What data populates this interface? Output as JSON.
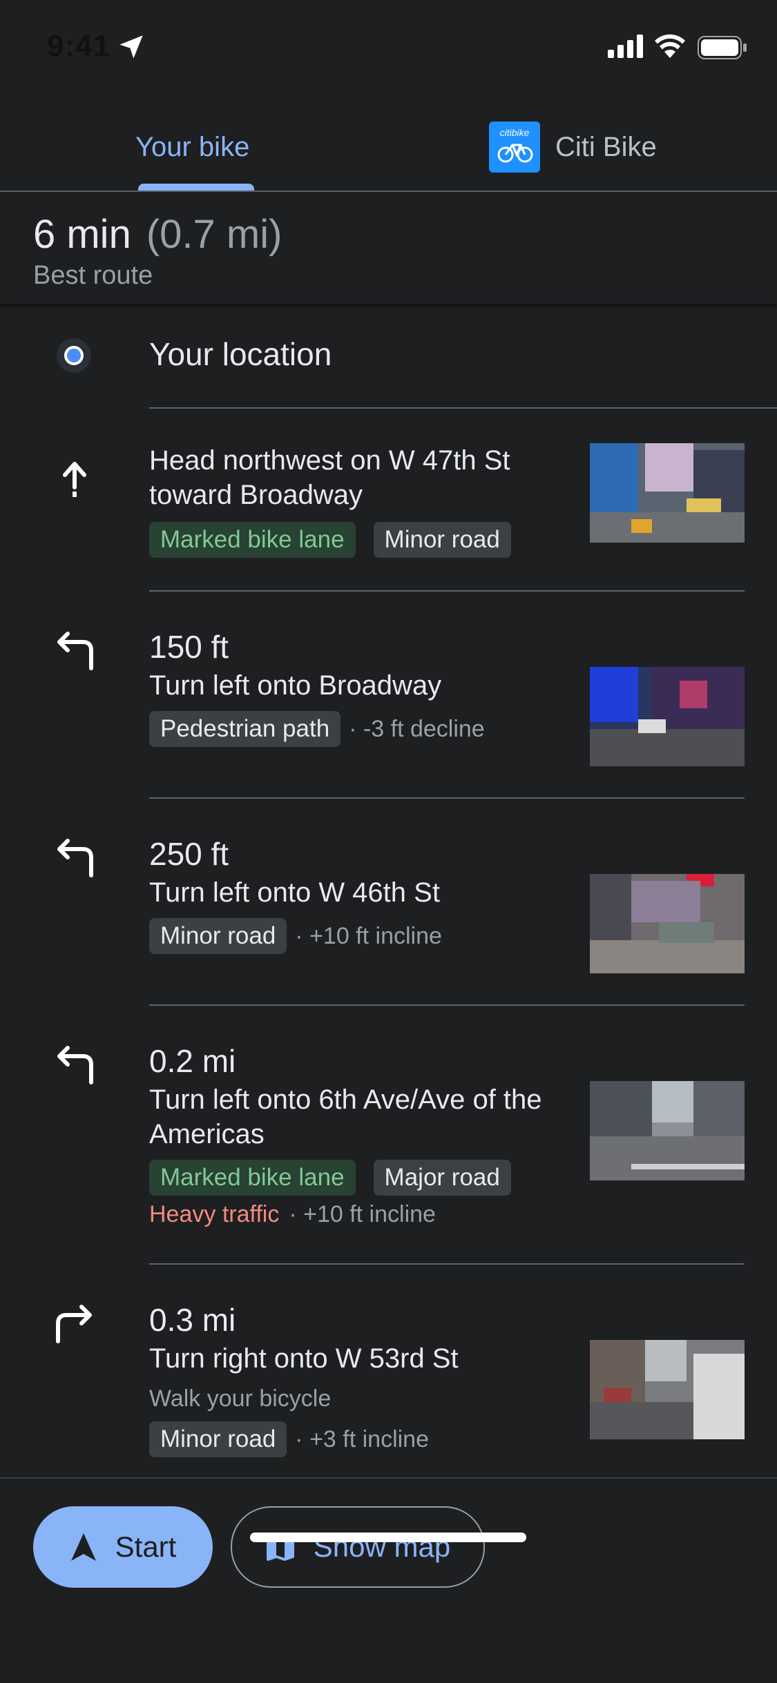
{
  "status_bar": {
    "time": "9:41"
  },
  "tabs": [
    {
      "label": "Your bike",
      "active": true
    },
    {
      "label": "Citi Bike",
      "active": false,
      "logo_text": "citibike"
    }
  ],
  "summary": {
    "duration": "6 min",
    "distance": "(0.7 mi)",
    "route_label": "Best route"
  },
  "origin": {
    "label": "Your location"
  },
  "steps": [
    {
      "icon": "straight-arrow-icon",
      "distance": "",
      "instruction": "Head northwest on W 47th St toward Broadway",
      "chips": [
        {
          "label": "Marked bike lane",
          "style": "green"
        },
        {
          "label": "Minor road",
          "style": "gray"
        }
      ],
      "meta": ""
    },
    {
      "icon": "turn-left-icon",
      "distance": "150 ft",
      "instruction": "Turn left onto Broadway",
      "chips": [
        {
          "label": "Pedestrian path",
          "style": "gray"
        }
      ],
      "meta": "· -3 ft decline"
    },
    {
      "icon": "turn-left-icon",
      "distance": "250 ft",
      "instruction": "Turn left onto W 46th St",
      "chips": [
        {
          "label": "Minor road",
          "style": "gray"
        }
      ],
      "meta": "· +10 ft incline"
    },
    {
      "icon": "turn-left-icon",
      "distance": "0.2 mi",
      "instruction": "Turn left onto 6th Ave/Ave of the Americas",
      "chips": [
        {
          "label": "Marked bike lane",
          "style": "green"
        },
        {
          "label": "Major road",
          "style": "gray"
        }
      ],
      "traffic": "Heavy traffic",
      "meta": "· +10 ft incline"
    },
    {
      "icon": "turn-right-icon",
      "distance": "0.3 mi",
      "instruction": "Turn right onto W 53rd St",
      "note": "Walk your bicycle",
      "chips": [
        {
          "label": "Minor road",
          "style": "gray"
        }
      ],
      "meta": "· +3 ft incline"
    }
  ],
  "actions": {
    "start_label": "Start",
    "show_map_label": "Show map"
  },
  "colors": {
    "accent": "#8ab4f8",
    "bike_lane_bg": "#284233",
    "bike_lane_text": "#81c995",
    "traffic_red": "#f28b82",
    "background": "#1e1f21"
  }
}
